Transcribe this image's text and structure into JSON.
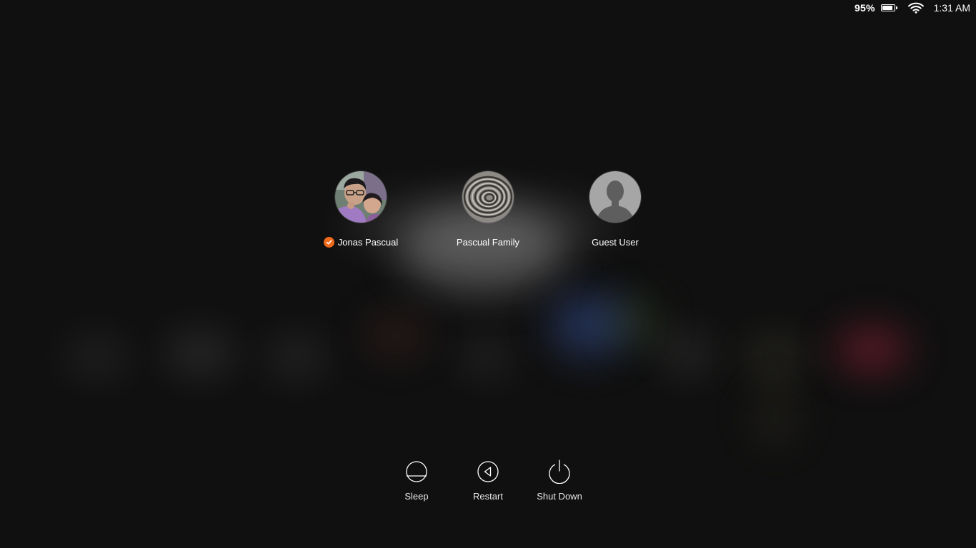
{
  "status_bar": {
    "battery_percent": "95%",
    "battery_level": 0.95,
    "battery_icon": "battery-icon",
    "wifi_icon": "wifi-icon",
    "time": "1:31 AM"
  },
  "users": [
    {
      "name": "Jonas Pascual",
      "selected": true,
      "avatar": "photo-avatar"
    },
    {
      "name": "Pascual Family",
      "selected": false,
      "avatar": "spiral-avatar"
    },
    {
      "name": "Guest User",
      "selected": false,
      "avatar": "silhouette-avatar"
    }
  ],
  "power": {
    "sleep_label": "Sleep",
    "restart_label": "Restart",
    "shutdown_label": "Shut Down"
  },
  "colors": {
    "background": "#101010",
    "selected_check": "#f06a1a",
    "text": "#ffffff"
  }
}
